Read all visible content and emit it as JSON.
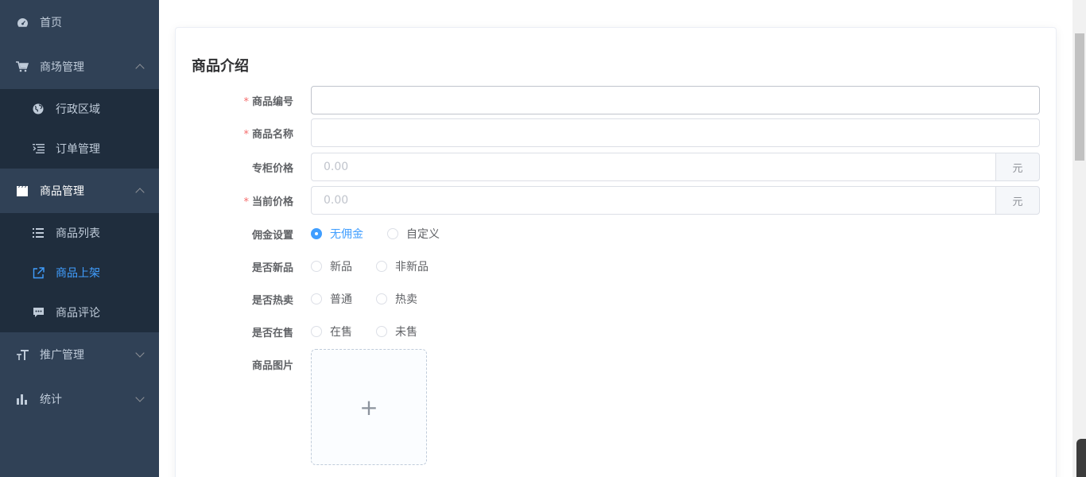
{
  "sidebar": {
    "items": [
      {
        "label": "首页",
        "icon": "dashboard-icon"
      },
      {
        "label": "商场管理",
        "icon": "cart-icon",
        "expanded": true,
        "children": [
          {
            "label": "行政区域",
            "icon": "globe-icon"
          },
          {
            "label": "订单管理",
            "icon": "list-indent-icon"
          }
        ]
      },
      {
        "label": "商品管理",
        "icon": "clapper-icon",
        "expanded": true,
        "children": [
          {
            "label": "商品列表",
            "icon": "list-icon"
          },
          {
            "label": "商品上架",
            "icon": "external-link-icon",
            "active": true
          },
          {
            "label": "商品评论",
            "icon": "comment-icon"
          }
        ]
      },
      {
        "label": "推广管理",
        "icon": "text-size-icon",
        "expanded": false
      },
      {
        "label": "统计",
        "icon": "bar-chart-icon",
        "expanded": false
      }
    ]
  },
  "card": {
    "title": "商品介绍",
    "fields": {
      "goods_sn": {
        "label": "商品编号",
        "required": true,
        "value": ""
      },
      "goods_name": {
        "label": "商品名称",
        "required": true,
        "value": ""
      },
      "counter_price": {
        "label": "专柜价格",
        "required": false,
        "placeholder": "0.00",
        "unit": "元"
      },
      "retail_price": {
        "label": "当前价格",
        "required": true,
        "placeholder": "0.00",
        "unit": "元"
      },
      "commission": {
        "label": "佣金设置",
        "options": [
          "无佣金",
          "自定义"
        ],
        "selected": "无佣金"
      },
      "is_new": {
        "label": "是否新品",
        "options": [
          "新品",
          "非新品"
        ],
        "selected": null
      },
      "is_hot": {
        "label": "是否热卖",
        "options": [
          "普通",
          "热卖"
        ],
        "selected": null
      },
      "is_on_sale": {
        "label": "是否在售",
        "options": [
          "在售",
          "未售"
        ],
        "selected": null
      },
      "picture": {
        "label": "商品图片",
        "upload_symbol": "+"
      }
    },
    "required_mark": "*"
  },
  "colors": {
    "sidebar_bg": "#304156",
    "submenu_bg": "#1f2d3d",
    "accent": "#409eff",
    "required": "#f56c6c"
  }
}
